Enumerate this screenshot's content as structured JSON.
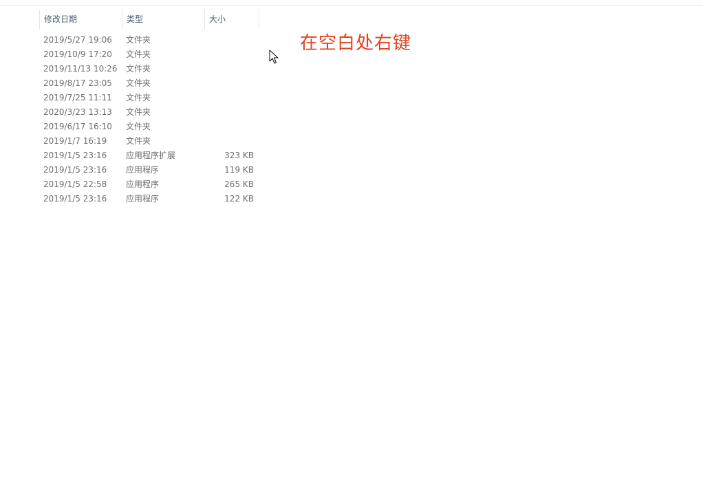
{
  "columns": {
    "date": "修改日期",
    "type": "类型",
    "size": "大小"
  },
  "rows": [
    {
      "date": "2019/5/27 19:06",
      "type": "文件夹",
      "size": ""
    },
    {
      "date": "2019/10/9 17:20",
      "type": "文件夹",
      "size": ""
    },
    {
      "date": "2019/11/13 10:26",
      "type": "文件夹",
      "size": ""
    },
    {
      "date": "2019/8/17 23:05",
      "type": "文件夹",
      "size": ""
    },
    {
      "date": "2019/7/25 11:11",
      "type": "文件夹",
      "size": ""
    },
    {
      "date": "2020/3/23 13:13",
      "type": "文件夹",
      "size": ""
    },
    {
      "date": "2019/6/17 16:10",
      "type": "文件夹",
      "size": ""
    },
    {
      "date": "2019/1/7 16:19",
      "type": "文件夹",
      "size": ""
    },
    {
      "date": "2019/1/5 23:16",
      "type": "应用程序扩展",
      "size": "323 KB"
    },
    {
      "date": "2019/1/5 23:16",
      "type": "应用程序",
      "size": "119 KB"
    },
    {
      "date": "2019/1/5 22:58",
      "type": "应用程序",
      "size": "265 KB"
    },
    {
      "date": "2019/1/5 23:16",
      "type": "应用程序",
      "size": "122 KB"
    }
  ],
  "annotation": {
    "text": "在空白处右键",
    "color": "#e4411e"
  },
  "cursor": {
    "icon": "mouse-pointer-icon"
  }
}
